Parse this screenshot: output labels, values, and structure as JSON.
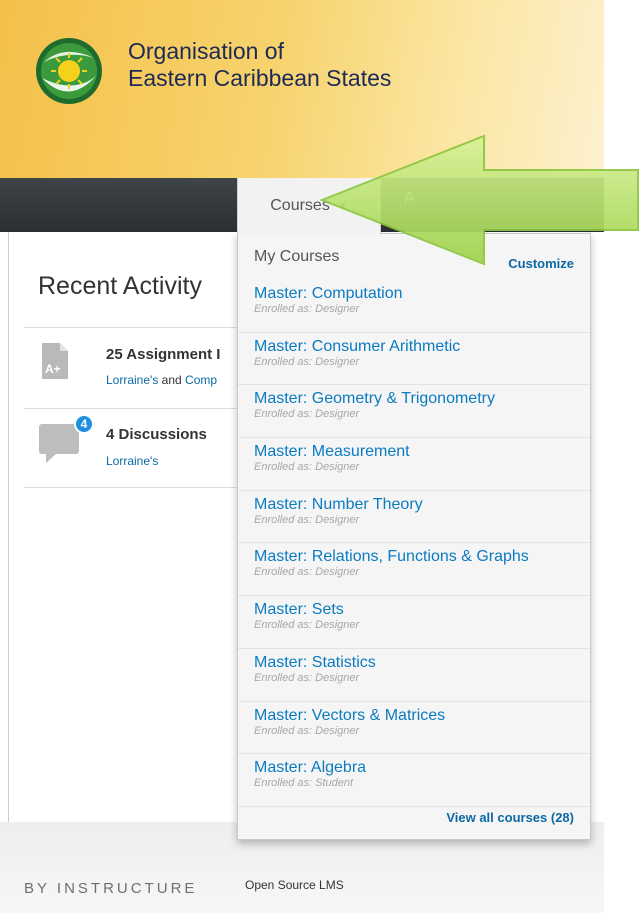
{
  "header": {
    "org_line1": "Organisation of",
    "org_line2": "Eastern Caribbean States"
  },
  "nav": {
    "courses_label": "Courses",
    "next_label": "A"
  },
  "dashboard": {
    "title": "Recent Activity",
    "activities": [
      {
        "icon": "assignment-icon",
        "title": "25 Assignment I",
        "sub_link1": "Lorraine's",
        "sub_mid": " and ",
        "sub_link2": "Comp"
      },
      {
        "icon": "discussion-icon",
        "badge": "4",
        "title": "4 Discussions",
        "sub_link1": "Lorraine's"
      }
    ]
  },
  "dropdown": {
    "heading": "My Courses",
    "customize": "Customize",
    "courses": [
      {
        "name": "Master: Computation",
        "role": "Enrolled as: Designer"
      },
      {
        "name": "Master: Consumer Arithmetic",
        "role": "Enrolled as: Designer"
      },
      {
        "name": "Master: Geometry & Trigonometry",
        "role": "Enrolled as: Designer"
      },
      {
        "name": "Master: Measurement",
        "role": "Enrolled as: Designer"
      },
      {
        "name": "Master: Number Theory",
        "role": "Enrolled as: Designer"
      },
      {
        "name": "Master: Relations, Functions & Graphs",
        "role": "Enrolled as: Designer"
      },
      {
        "name": "Master: Sets",
        "role": "Enrolled as: Designer"
      },
      {
        "name": "Master: Statistics",
        "role": "Enrolled as: Designer"
      },
      {
        "name": "Master: Vectors & Matrices",
        "role": "Enrolled as: Designer"
      },
      {
        "name": "Master: Algebra",
        "role": "Enrolled as: Student"
      }
    ],
    "view_all": "View all courses (28)"
  },
  "footer": {
    "brand": "BY INSTRUCTURE",
    "link": "Open Source LMS"
  },
  "colors": {
    "link": "#0b7bc1",
    "navbar": "#2f3337",
    "annotation_arrow": "#b6e46a"
  }
}
